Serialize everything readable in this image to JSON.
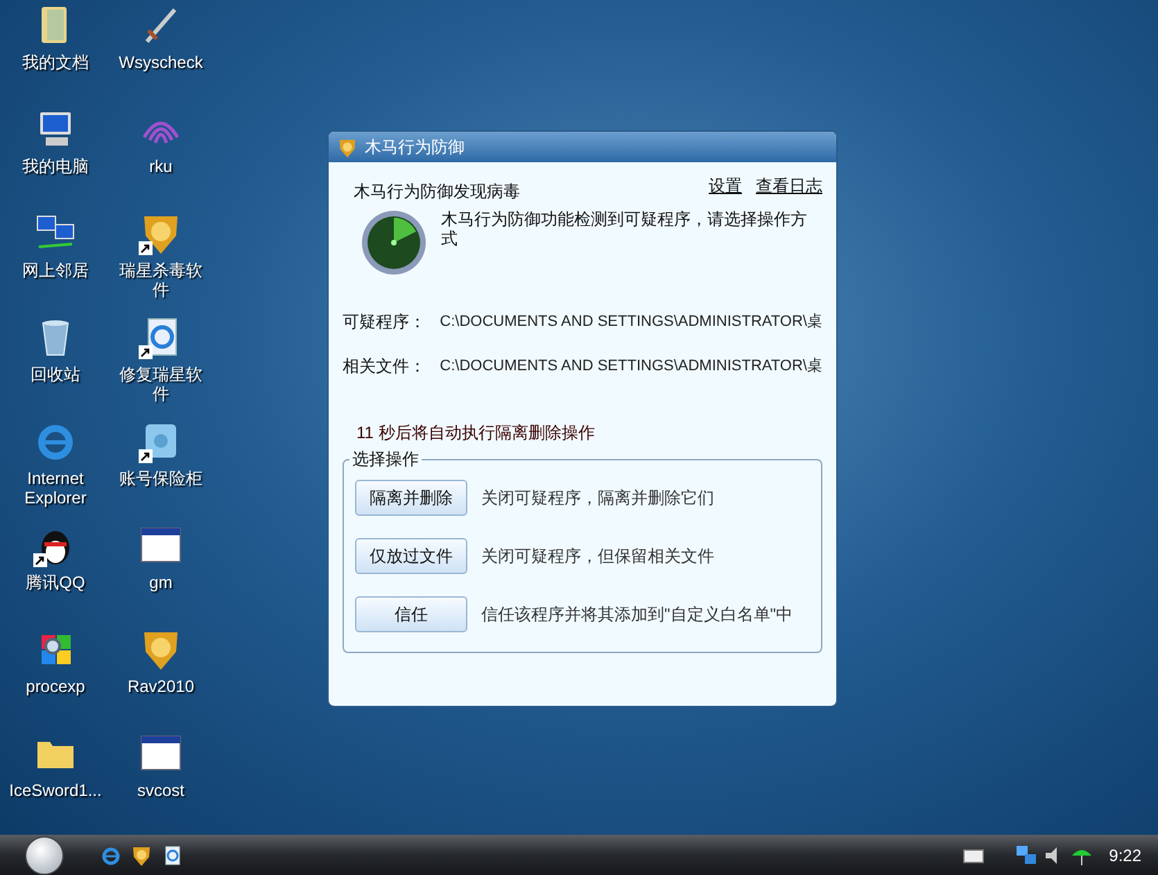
{
  "desktop_icons": [
    {
      "label": "我的文档",
      "kind": "documents",
      "shortcut": false
    },
    {
      "label": "Wsyscheck",
      "kind": "sword",
      "shortcut": false
    },
    {
      "label": "我的电脑",
      "kind": "computer",
      "shortcut": false
    },
    {
      "label": "rku",
      "kind": "waves",
      "shortcut": false
    },
    {
      "label": "网上邻居",
      "kind": "network",
      "shortcut": false
    },
    {
      "label": "瑞星杀毒软件",
      "kind": "lion",
      "shortcut": true
    },
    {
      "label": "回收站",
      "kind": "recycle",
      "shortcut": false
    },
    {
      "label": "修复瑞星软件",
      "kind": "iedoc",
      "shortcut": true
    },
    {
      "label": "Internet Explorer",
      "kind": "ie",
      "shortcut": false
    },
    {
      "label": "账号保险柜",
      "kind": "safe",
      "shortcut": true
    },
    {
      "label": "腾讯QQ",
      "kind": "qq",
      "shortcut": true
    },
    {
      "label": "gm",
      "kind": "window",
      "shortcut": false
    },
    {
      "label": "procexp",
      "kind": "windows",
      "shortcut": false
    },
    {
      "label": "Rav2010",
      "kind": "lion",
      "shortcut": false
    },
    {
      "label": "IceSword1...",
      "kind": "folder",
      "shortcut": false
    },
    {
      "label": "svcost",
      "kind": "window",
      "shortcut": false
    }
  ],
  "dialog": {
    "title": "木马行为防御",
    "heading": "木马行为防御发现病毒",
    "links": [
      "设置",
      "查看日志"
    ],
    "message": "木马行为防御功能检测到可疑程序，请选择操作方式",
    "fields": [
      {
        "label": "可疑程序：",
        "value": "C:\\DOCUMENTS AND SETTINGS\\ADMINISTRATOR\\桌"
      },
      {
        "label": "相关文件：",
        "value": "C:\\DOCUMENTS AND SETTINGS\\ADMINISTRATOR\\桌"
      }
    ],
    "countdown": "11 秒后将自动执行隔离删除操作",
    "group_title": "选择操作",
    "actions": [
      {
        "button": "隔离并删除",
        "description": "关闭可疑程序，隔离并删除它们"
      },
      {
        "button": "仅放过文件",
        "description": "关闭可疑程序，但保留相关文件"
      },
      {
        "button": "信任",
        "description": "信任该程序并将其添加到\"自定义白名单\"中"
      }
    ]
  },
  "taskbar": {
    "clock": "9:22"
  }
}
